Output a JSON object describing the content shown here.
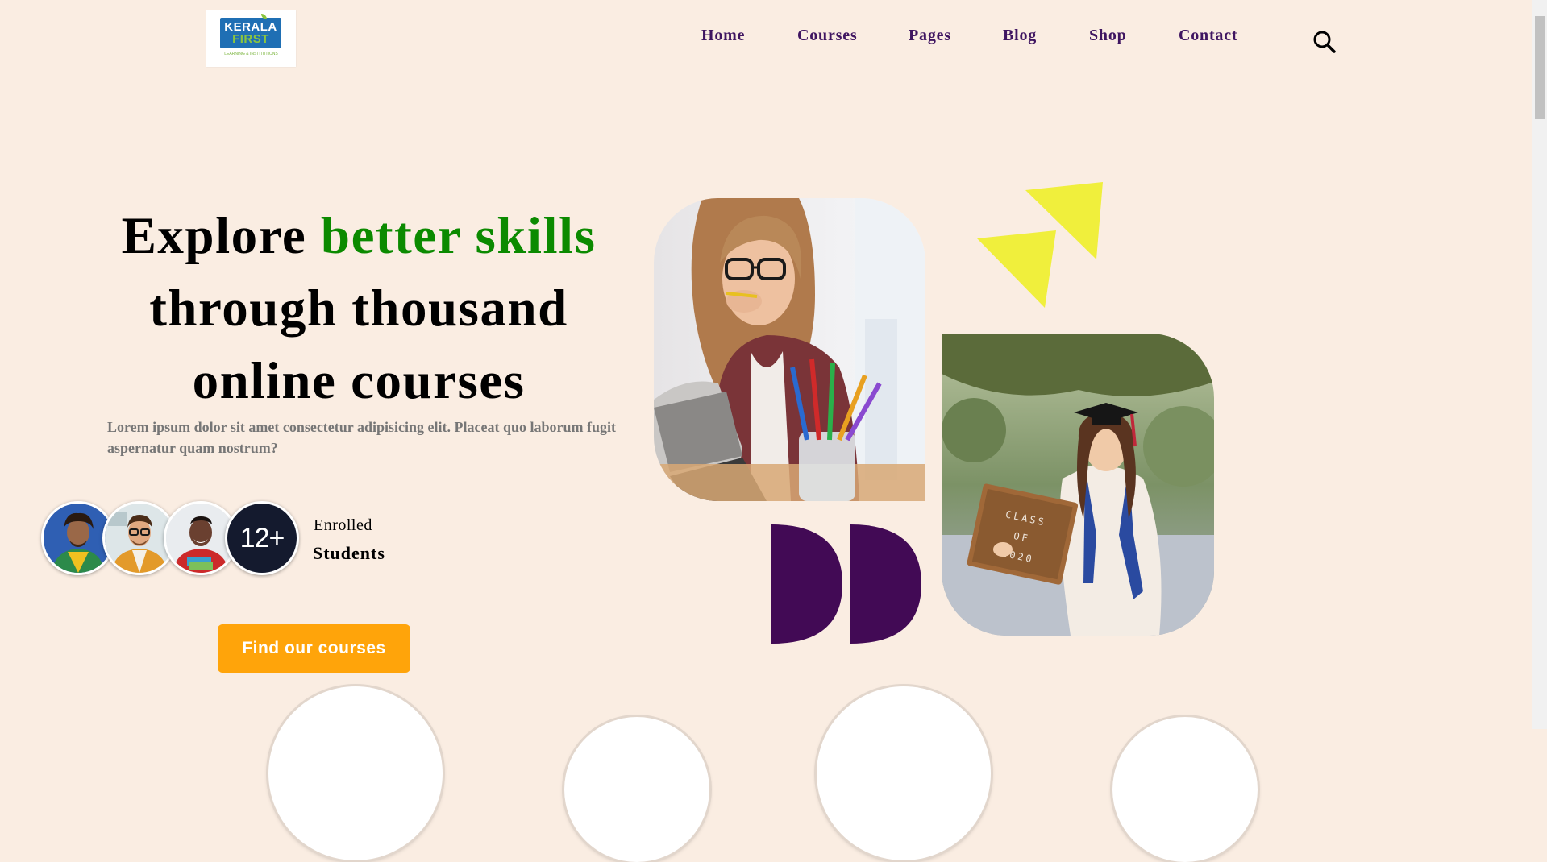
{
  "brand": {
    "logo_line1": "KERALA",
    "logo_line2": "FIRST",
    "logo_subtext": "LEARNING & INSTITUTIONS"
  },
  "nav": {
    "items": [
      {
        "label": "Home"
      },
      {
        "label": "Courses"
      },
      {
        "label": "Pages"
      },
      {
        "label": "Blog"
      },
      {
        "label": "Shop"
      },
      {
        "label": "Contact"
      }
    ],
    "search_icon": "search-icon"
  },
  "hero": {
    "title_part1": "Explore ",
    "title_accent": "better skills",
    "title_line2": "through thousand",
    "title_line3": "online courses",
    "description": "Lorem ipsum dolor sit amet consectetur adipisicing elit. Placeat quo laborum fugit aspernatur quam nostrum?",
    "students_count": "12+",
    "enrolled_label": "Enrolled",
    "students_label": "Students",
    "cta_label": "Find our courses"
  },
  "images": {
    "photo1_sign": "",
    "photo2_sign_line1": "CLASS",
    "photo2_sign_line2": "OF",
    "photo2_sign_line3": "2020"
  },
  "colors": {
    "background": "#faede2",
    "accent_green": "#0b8a00",
    "nav_purple": "#3f1561",
    "cta_orange": "#ffa40a",
    "deco_yellow": "#f0ef3c",
    "deco_purple": "#420a55"
  }
}
